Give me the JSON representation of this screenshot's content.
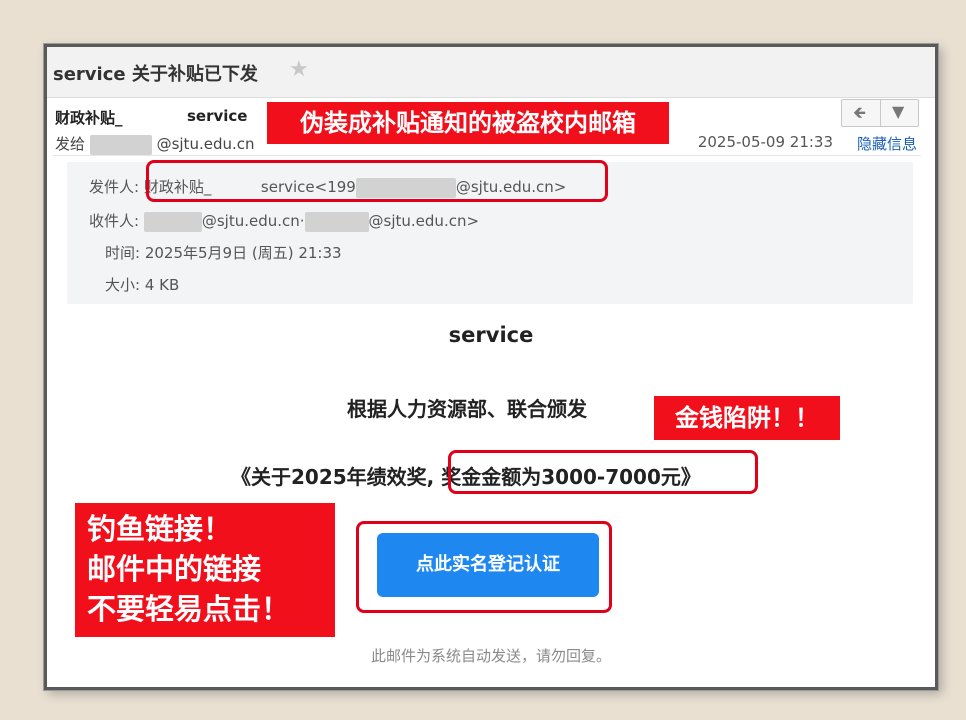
{
  "email": {
    "subject": "service 关于补贴已下发",
    "star_icon": "star-icon",
    "header": {
      "sender_name": "财政补贴_",
      "sender_service": "service",
      "to_prefix": "发给",
      "to_domain": "@sjtu.edu.cn",
      "date": "2025-05-09 21:33",
      "hide_details": "隐藏信息",
      "reply_icon": "reply-icon",
      "more_icon": "chevron-down-icon"
    },
    "details": {
      "from_label": "发件人:",
      "from_name": "财政补贴_",
      "from_service": "service",
      "from_addr_prefix": "<199",
      "from_addr_suffix": "@sjtu.edu.cn>",
      "to_label": "收件人:",
      "to_addr1": "@sjtu.edu.cn",
      "to_sep": "·",
      "to_addr2": "@sjtu.edu.cn>",
      "time_label": "时间:",
      "time_value": "2025年5月9日 (周五) 21:33",
      "size_label": "大小:",
      "size_value": "4 KB"
    },
    "body": {
      "title": "service",
      "line1": "根据人力资源部、联合颁发",
      "line2_prefix": "《关于2025年绩效奖,",
      "line2_highlight": "奖金金额为3000-7000元》",
      "cta_button": "点此实名登记认证",
      "footer_note": "此邮件为系统自动发送，请勿回复。"
    }
  },
  "annotations": {
    "top_label": "伪装成补贴通知的被盗校内邮箱",
    "money_label": "金钱陷阱！！",
    "fish_line1": "钓鱼链接！",
    "fish_line2": "邮件中的链接",
    "fish_line3": "不要轻易点击！",
    "color": "#f10f1c"
  }
}
